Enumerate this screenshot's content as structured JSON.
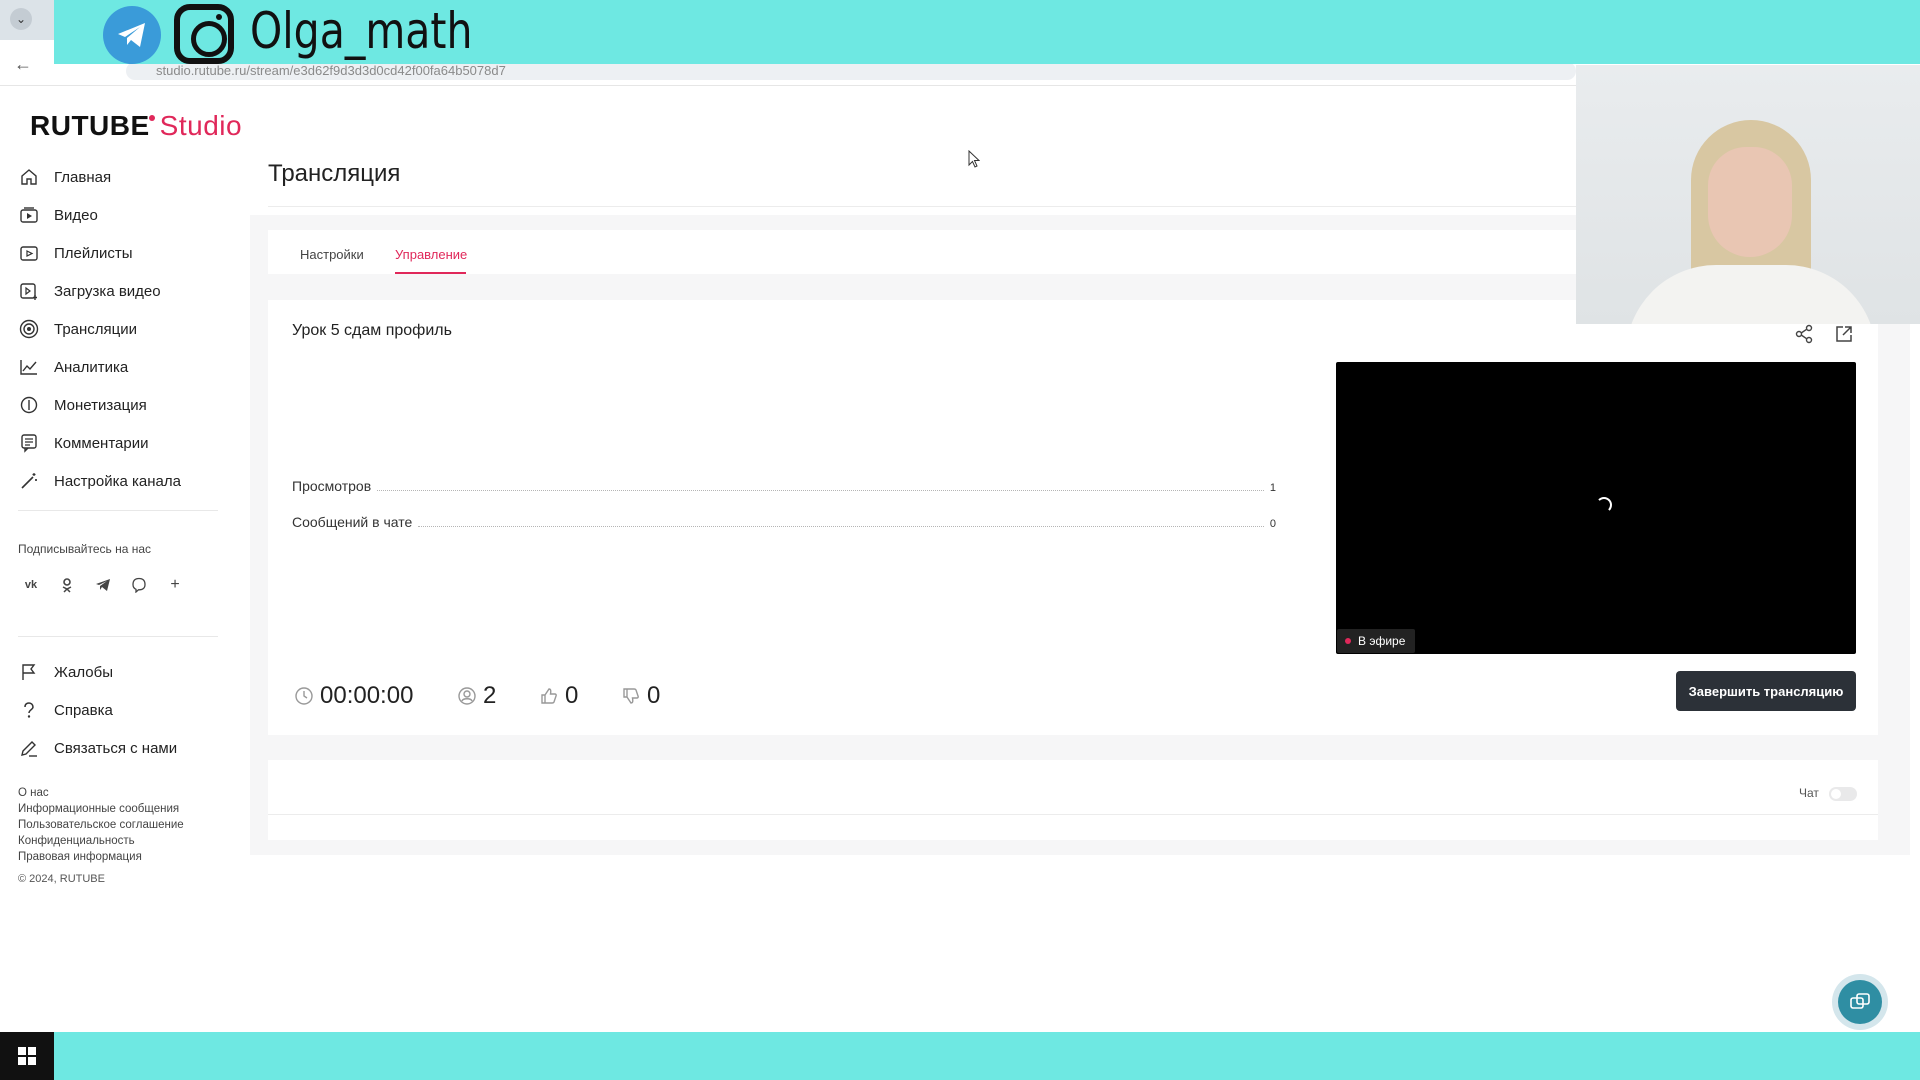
{
  "banner": {
    "handle": "Olga_math"
  },
  "browser": {
    "url": "studio.rutube.ru/stream/e3d62f9d3d3d0cd42f00fa64b5078d7"
  },
  "logo": {
    "brand": "RUTUBE",
    "product": "Studio"
  },
  "sidebar": {
    "items": [
      {
        "label": "Главная",
        "icon": "home-icon"
      },
      {
        "label": "Видео",
        "icon": "video-icon"
      },
      {
        "label": "Плейлисты",
        "icon": "playlist-icon"
      },
      {
        "label": "Загрузка видео",
        "icon": "upload-icon"
      },
      {
        "label": "Трансляции",
        "icon": "broadcast-icon"
      },
      {
        "label": "Аналитика",
        "icon": "analytics-icon"
      },
      {
        "label": "Монетизация",
        "icon": "monetization-icon"
      },
      {
        "label": "Комментарии",
        "icon": "comments-icon"
      },
      {
        "label": "Настройка канала",
        "icon": "wand-icon"
      }
    ],
    "subscribe_label": "Подписывайтесь на нас",
    "socials": [
      "vk-icon",
      "ok-icon",
      "telegram-icon",
      "viber-icon",
      "plus-icon"
    ],
    "secondary_items": [
      {
        "label": "Жалобы",
        "icon": "flag-icon"
      },
      {
        "label": "Справка",
        "icon": "help-icon"
      },
      {
        "label": "Связаться с нами",
        "icon": "pencil-icon"
      }
    ],
    "footer_links": [
      "О нас",
      "Информационные сообщения",
      "Пользовательское соглашение",
      "Конфиденциальность",
      "Правовая информация"
    ],
    "copyright": "© 2024, RUTUBE"
  },
  "main": {
    "title": "Трансляция",
    "tabs": [
      {
        "label": "Настройки",
        "active": false
      },
      {
        "label": "Управление",
        "active": true
      }
    ],
    "stream": {
      "title": "Урок 5 сдам профиль",
      "stats": [
        {
          "label": "Просмотров",
          "value": "1"
        },
        {
          "label": "Сообщений в чате",
          "value": "0"
        }
      ],
      "duration": "00:00:00",
      "viewers": "2",
      "likes": "0",
      "dislikes": "0",
      "live_label": "В эфире",
      "end_button": "Завершить трансляцию"
    },
    "chat": {
      "label": "Чат",
      "enabled": false
    }
  },
  "colors": {
    "accent": "#e0285a",
    "banner": "#6ee8e2",
    "button": "#2c3138"
  }
}
